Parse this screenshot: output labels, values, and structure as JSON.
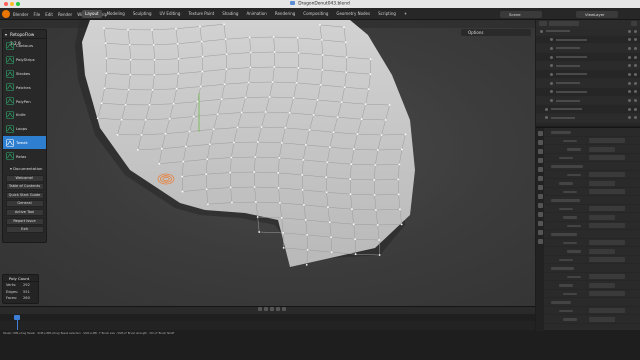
{
  "window": {
    "title": "DragonDonut043.blend"
  },
  "menus": [
    "Blender",
    "File",
    "Edit",
    "Render",
    "Window",
    "Help"
  ],
  "workspaces": {
    "tabs": [
      "Layout",
      "Modeling",
      "Sculpting",
      "UV Editing",
      "Texture Paint",
      "Shading",
      "Animation",
      "Rendering",
      "Compositing",
      "Geometry Nodes",
      "Scripting",
      "+"
    ],
    "active": "Layout"
  },
  "header_right": {
    "scene": "Scene",
    "view_layer": "ViewLayer"
  },
  "viewport": {
    "options_label": "Options"
  },
  "retopoflow": {
    "title": "RetopoFlow 3.2.9",
    "tools": [
      {
        "label": "Contours",
        "icon": "contours-icon",
        "active": false
      },
      {
        "label": "PolyStrips",
        "icon": "polystrips-icon",
        "active": false
      },
      {
        "label": "Strokes",
        "icon": "strokes-icon",
        "active": false
      },
      {
        "label": "Patches",
        "icon": "patches-icon",
        "active": false
      },
      {
        "label": "PolyPen",
        "icon": "polypen-icon",
        "active": false
      },
      {
        "label": "Knife",
        "icon": "knife-icon",
        "active": false
      },
      {
        "label": "Loops",
        "icon": "loops-icon",
        "active": false
      },
      {
        "label": "Tweak",
        "icon": "tweak-icon",
        "active": true
      },
      {
        "label": "Relax",
        "icon": "relax-icon",
        "active": false
      }
    ],
    "documentation_label": "Documentation",
    "doc_buttons": [
      "Welcome!",
      "Table of Contents",
      "Quick Start Guide",
      "General",
      "Active Tool"
    ],
    "extra_buttons": [
      "Report Issue",
      "Exit"
    ]
  },
  "poly_count": {
    "title": "Poly Count",
    "rows": [
      {
        "label": "Verts:",
        "value": "292"
      },
      {
        "label": "Edges:",
        "value": "551"
      },
      {
        "label": "Faces:",
        "value": "260"
      }
    ]
  },
  "status_bar": {
    "text": "Tweak: LMB+drag  Tweak   ·   Shift+LMB+Drag  Tweak selection   ·   Shift+LMB   ·   F  Brush size   ·   Shift+F  Brush strength   ·   Ctrl+F  Brush falloff"
  },
  "colors": {
    "accent": "#2f7fd1",
    "blender_logo": "#ea7600",
    "mesh_fill": "#c8c8c8",
    "brush": "#e8803a"
  }
}
